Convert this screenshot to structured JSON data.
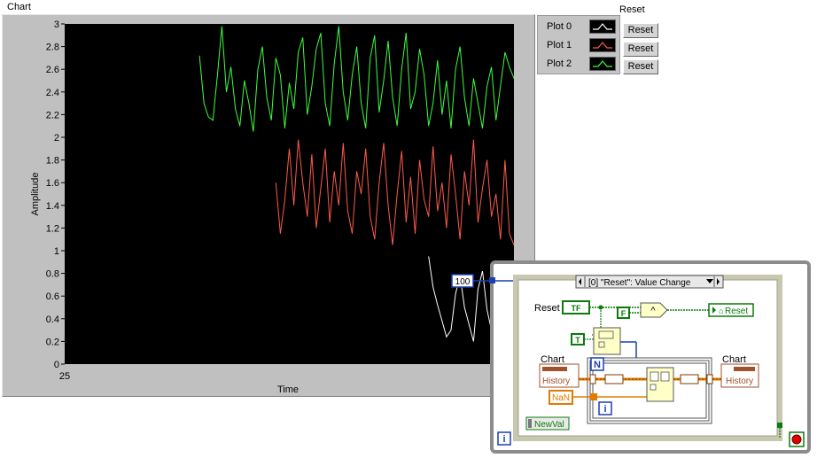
{
  "chart": {
    "title": "Chart",
    "ylabel": "Amplitude",
    "xlabel": "Time",
    "x_start_label": "25",
    "y_ticks": [
      "0",
      "0.2",
      "0.4",
      "0.6",
      "0.8",
      "1",
      "1.2",
      "1.4",
      "1.6",
      "1.8",
      "2",
      "2.2",
      "2.4",
      "2.6",
      "2.8",
      "3"
    ],
    "background_color": "#000000",
    "frame_color": "#c0c0c0"
  },
  "legend": {
    "items": [
      {
        "label": "Plot 0",
        "color": "#ffffff"
      },
      {
        "label": "Plot 1",
        "color": "#ff5a4a"
      },
      {
        "label": "Plot 2",
        "color": "#3cff3c"
      }
    ]
  },
  "reset_panel": {
    "title": "Reset",
    "buttons": [
      "Reset",
      "Reset",
      "Reset"
    ]
  },
  "diagram": {
    "constant_100": "100",
    "event_case_label": "[0] \"Reset\": Value Change",
    "reset_terminal_label": "Reset",
    "reset_terminal_type": "TF",
    "false_const": "F",
    "true_const": "T",
    "and_symbol": "^",
    "reset_local_label": "Reset",
    "chart_label_left": "Chart",
    "chart_label_right": "Chart",
    "history_left": "History",
    "history_right": "History",
    "nan_label": "NaN",
    "n_label": "N",
    "i_label_inner": "i",
    "i_label_outer": "i",
    "newval_label": "NewVal"
  },
  "chart_data": {
    "type": "line",
    "title": "Chart",
    "xlabel": "Time",
    "ylabel": "Amplitude",
    "ylim": [
      0,
      3
    ],
    "x_start": 25,
    "x_end": 125,
    "grid": false,
    "legend_position": "top-right",
    "series": [
      {
        "name": "Plot 0",
        "color": "#ffffff",
        "x": [
          106,
          107,
          108,
          109,
          110,
          111,
          112,
          113,
          114,
          115,
          116,
          117,
          118,
          119,
          120,
          121,
          122,
          123,
          124,
          125
        ],
        "values": [
          0.95,
          0.68,
          0.52,
          0.38,
          0.24,
          0.3,
          0.62,
          0.78,
          0.5,
          0.35,
          0.2,
          0.66,
          0.82,
          0.48,
          0.3,
          0.16,
          0.72,
          0.9,
          0.55,
          0.4
        ]
      },
      {
        "name": "Plot 1",
        "color": "#ff5a4a",
        "x": [
          72,
          73,
          74,
          75,
          76,
          77,
          78,
          79,
          80,
          81,
          82,
          83,
          84,
          85,
          86,
          87,
          88,
          89,
          90,
          91,
          92,
          93,
          94,
          95,
          96,
          97,
          98,
          99,
          100,
          101,
          102,
          103,
          104,
          105,
          106,
          107,
          108,
          109,
          110,
          111,
          112,
          113,
          114,
          115,
          116,
          117,
          118,
          119,
          120,
          121,
          122,
          123,
          124,
          125
        ],
        "values": [
          1.6,
          1.15,
          1.45,
          1.9,
          1.4,
          1.98,
          1.6,
          1.3,
          1.85,
          1.2,
          1.55,
          1.9,
          1.25,
          1.7,
          1.4,
          1.95,
          1.35,
          1.15,
          1.7,
          1.5,
          1.9,
          1.3,
          1.1,
          1.6,
          1.95,
          1.4,
          1.05,
          1.5,
          1.88,
          1.25,
          1.65,
          1.15,
          1.8,
          1.45,
          1.3,
          1.92,
          1.35,
          1.6,
          1.2,
          1.85,
          1.5,
          1.1,
          1.7,
          1.4,
          1.98,
          1.25,
          1.55,
          1.8,
          1.3,
          1.5,
          1.1,
          1.8,
          1.15,
          1.05
        ]
      },
      {
        "name": "Plot 2",
        "color": "#3cff3c",
        "x": [
          55,
          56,
          57,
          58,
          59,
          60,
          61,
          62,
          63,
          64,
          65,
          66,
          67,
          68,
          69,
          70,
          71,
          72,
          73,
          74,
          75,
          76,
          77,
          78,
          79,
          80,
          81,
          82,
          83,
          84,
          85,
          86,
          87,
          88,
          89,
          90,
          91,
          92,
          93,
          94,
          95,
          96,
          97,
          98,
          99,
          100,
          101,
          102,
          103,
          104,
          105,
          106,
          107,
          108,
          109,
          110,
          111,
          112,
          113,
          114,
          115,
          116,
          117,
          118,
          119,
          120,
          121,
          122,
          123,
          124,
          125
        ],
        "values": [
          2.72,
          2.3,
          2.18,
          2.15,
          2.55,
          2.98,
          2.4,
          2.62,
          2.25,
          2.1,
          2.5,
          2.3,
          2.05,
          2.6,
          2.8,
          2.35,
          2.15,
          2.7,
          2.55,
          2.08,
          2.48,
          2.25,
          2.75,
          2.88,
          2.2,
          2.45,
          2.78,
          2.92,
          2.3,
          2.1,
          2.65,
          2.98,
          2.4,
          2.15,
          2.55,
          2.8,
          2.3,
          2.08,
          2.7,
          2.9,
          2.22,
          2.5,
          2.85,
          2.35,
          2.1,
          2.6,
          2.92,
          2.25,
          2.4,
          2.78,
          2.55,
          2.1,
          2.3,
          2.68,
          2.2,
          2.5,
          2.08,
          2.6,
          2.8,
          2.35,
          2.1,
          2.52,
          2.3,
          2.08,
          2.45,
          2.62,
          2.15,
          2.45,
          2.75,
          2.62,
          2.52
        ]
      }
    ]
  }
}
